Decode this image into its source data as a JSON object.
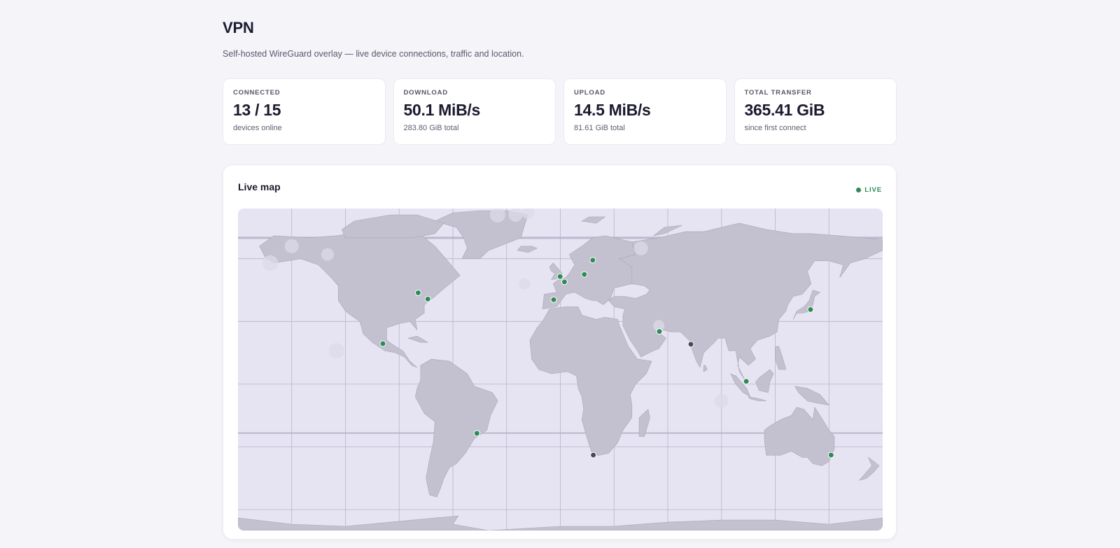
{
  "header": {
    "title": "VPN",
    "subtitle": "Self-hosted WireGuard overlay — live device connections, traffic and location."
  },
  "stats": [
    {
      "label": "CONNECTED",
      "value": "13 / 15",
      "note": "devices online"
    },
    {
      "label": "DOWNLOAD",
      "value": "50.1 MiB/s",
      "note": "283.80 GiB total"
    },
    {
      "label": "UPLOAD",
      "value": "14.5 MiB/s",
      "note": "81.61 GiB total"
    },
    {
      "label": "TOTAL TRANSFER",
      "value": "365.41 GiB",
      "note": "since first connect"
    }
  ],
  "map": {
    "title": "Live map",
    "live_label": "LIVE",
    "colors": {
      "online": "#2e8b57",
      "offline": "#4a4a55",
      "land": "#c3c0d0",
      "ocean": "#e6e3f3"
    },
    "devices": [
      {
        "status": "online",
        "lat": 43.7,
        "lon": -79.4
      },
      {
        "status": "online",
        "lat": 40.7,
        "lon": -74.0
      },
      {
        "status": "online",
        "lat": 19.4,
        "lon": -99.1
      },
      {
        "status": "online",
        "lat": -23.5,
        "lon": -46.6
      },
      {
        "status": "online",
        "lat": 51.5,
        "lon": -0.1
      },
      {
        "status": "online",
        "lat": 48.9,
        "lon": 2.3
      },
      {
        "status": "online",
        "lat": 40.4,
        "lon": -3.7
      },
      {
        "status": "online",
        "lat": 52.5,
        "lon": 13.4
      },
      {
        "status": "online",
        "lat": 59.3,
        "lon": 18.1
      },
      {
        "status": "online",
        "lat": 25.2,
        "lon": 55.3
      },
      {
        "status": "offline",
        "lat": 19.1,
        "lon": 72.9
      },
      {
        "status": "online",
        "lat": 1.35,
        "lon": 103.8
      },
      {
        "status": "online",
        "lat": 35.7,
        "lon": 139.7
      },
      {
        "status": "online",
        "lat": -33.9,
        "lon": 151.2
      },
      {
        "status": "offline",
        "lat": -33.9,
        "lon": 18.4
      }
    ]
  }
}
